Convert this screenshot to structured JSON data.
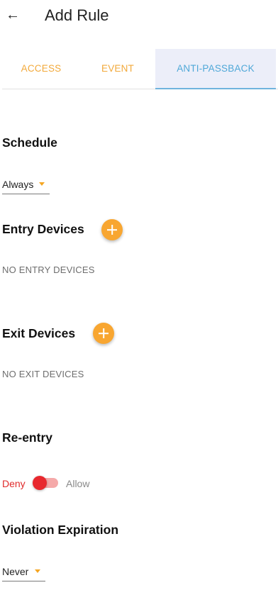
{
  "header": {
    "back_icon": "←",
    "title": "Add Rule"
  },
  "tabs": [
    {
      "label": "ACCESS"
    },
    {
      "label": "EVENT"
    },
    {
      "label": "ANTI-PASSBACK",
      "active": true
    }
  ],
  "schedule": {
    "title": "Schedule",
    "value": "Always"
  },
  "entry": {
    "title": "Entry Devices",
    "empty_text": "NO ENTRY DEVICES",
    "add_icon": "plus-icon"
  },
  "exit": {
    "title": "Exit Devices",
    "empty_text": "NO EXIT DEVICES",
    "add_icon": "plus-icon"
  },
  "reentry": {
    "title": "Re-entry",
    "deny_label": "Deny",
    "allow_label": "Allow",
    "selected": "Deny"
  },
  "violation": {
    "title": "Violation Expiration",
    "value": "Never"
  },
  "colors": {
    "accent": "#f8a631",
    "active_tab": "#4fa8d8",
    "deny": "#e8282e"
  }
}
